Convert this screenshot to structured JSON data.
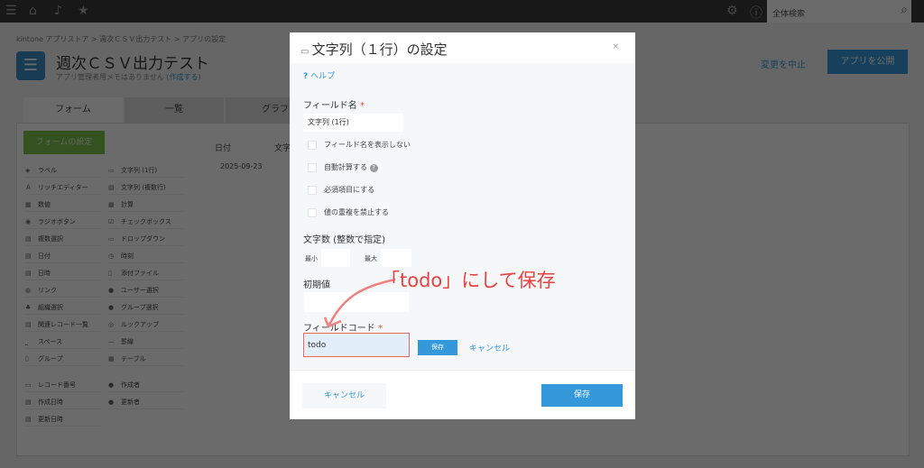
{
  "topbar": {
    "search_placeholder": "全体検索"
  },
  "breadcrumb": [
    "kintone アプリストア",
    "週次ＣＳＶ出力テスト",
    "アプリの設定"
  ],
  "app": {
    "title": "週次ＣＳＶ出力テスト",
    "subtitle": "アプリ管理者用メモはありません",
    "subtitle_link": "作成する",
    "stop_label": "変更を中止",
    "publish_label": "アプリを公開"
  },
  "tabs": [
    "フォーム",
    "一覧",
    "グラフ"
  ],
  "form_button": "フォームの設定",
  "palette": [
    "ラベル",
    "文字列 (1行)",
    "リッチエディター",
    "文字列 (複数行)",
    "数値",
    "計算",
    "ラジオボタン",
    "チェックボックス",
    "複数選択",
    "ドロップダウン",
    "日付",
    "時刻",
    "日時",
    "添付ファイル",
    "リンク",
    "ユーザー選択",
    "組織選択",
    "グループ選択",
    "関連レコード一覧",
    "ルックアップ",
    "スペース",
    "罫線",
    "グループ",
    "テーブル",
    "レコード番号",
    "作成者",
    "作成日時",
    "更新者",
    "更新日時"
  ],
  "form_preview": {
    "headers": [
      "日付",
      "文字"
    ],
    "date_value": "2025-09-23"
  },
  "modal": {
    "title": "文字列（１行）の設定",
    "close": "×",
    "help": "ヘルプ",
    "field_name_label": "フィールド名",
    "field_name_value": "文字列 (1行)",
    "checkboxes": [
      "フィールド名を表示しない",
      "自動計算する",
      "必須項目にする",
      "値の重複を禁止する"
    ],
    "length_label": "文字数 (整数で指定)",
    "min_label": "最小",
    "max_label": "最大",
    "default_label": "初期値",
    "code_label": "フィールドコード",
    "code_value": "todo",
    "inline_save": "保存",
    "inline_cancel": "キャンセル",
    "cancel": "キャンセル",
    "save": "保存"
  },
  "annotation": "「todo」にして保存",
  "colors": {
    "accent": "#3498db",
    "annotation": "#e8413e",
    "form_button": "#7cc34c"
  }
}
